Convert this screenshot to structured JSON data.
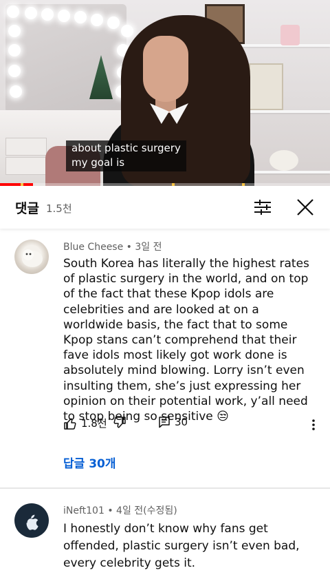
{
  "video": {
    "caption": "about plastic surgery\nmy goal is",
    "progress_fraction": 0.1
  },
  "comments_panel": {
    "title": "댓글",
    "count": "1.5천"
  },
  "comments": [
    {
      "author": "Blue Cheese",
      "time": "3일 전",
      "text": "South Korea has literally the highest rates of plastic surgery in the world, and on top of the fact that these Kpop idols are celebrities and are looked at on a worldwide basis, the fact that to some Kpop stans can’t comprehend that their fave idols most likely got work done is absolutely mind blowing. Lorry isn’t even insulting them, she’s just expressing her opinion on their potential work, y’all need to stop being so sensitive 😒",
      "likes": "1.8천",
      "reply_count": "30",
      "view_replies": "답글 30개"
    },
    {
      "author": "iNeft101",
      "time": "4일 전(수정됨)",
      "text": "I honestly don’t know why fans get offended, plastic surgery isn’t even bad, every celebrity gets it."
    }
  ],
  "colors": {
    "accent_link": "#065fd4",
    "progress": "#ff0000",
    "secondary_text": "#606060"
  }
}
